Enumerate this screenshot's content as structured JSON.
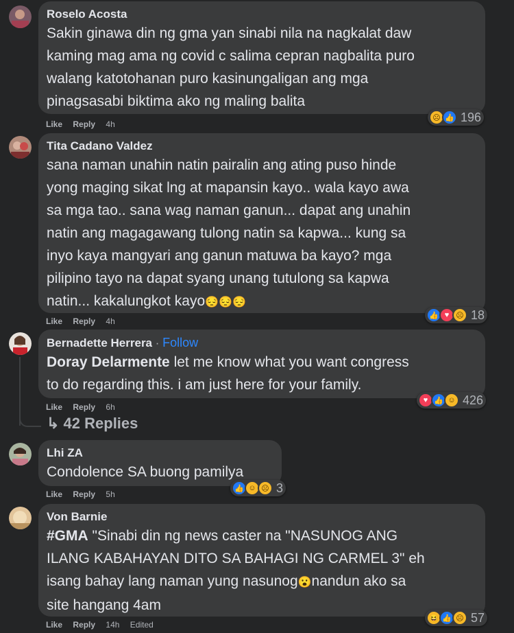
{
  "colors": {
    "background": "#242526",
    "bubble": "#3a3b3c",
    "link": "#2d88ff",
    "secondary": "#b0b3b8"
  },
  "comments": [
    {
      "author": "Roselo Acosta",
      "text": "Sakin ginawa din ng gma yan sinabi nila na nagkalat daw\nkaming mag ama ng covid c salima cepran nagbalita puro\nwalang katotohanan puro kasinungaligan ang mga\npinagsasabi biktima ako ng maling balita",
      "like": "Like",
      "reply": "Reply",
      "time": "4h",
      "reactions": [
        "sad",
        "like"
      ],
      "count": "196"
    },
    {
      "author": "Tita Cadano Valdez",
      "text": "sana naman unahin natin pairalin ang ating puso hinde\nyong maging sikat lng at mapansin kayo.. wala kayo awa\nsa mga tao.. sana wag naman ganun... dapat ang unahin\nnatin ang magagawang tulong natin sa kapwa... kung sa\ninyo kaya mangyari ang ganun matuwa ba kayo? mga\npilipino tayo na dapat syang unang tutulong sa kapwa\nnatin... kakalungkot kayo",
      "emoji_trail": "😔😔😔",
      "like": "Like",
      "reply": "Reply",
      "time": "4h",
      "reactions": [
        "like",
        "love",
        "sad"
      ],
      "count": "18"
    },
    {
      "author": "Bernadette Herrera",
      "dot": "·",
      "follow": "Follow",
      "mention": "Doray Delarmente",
      "text": " let me know what you want congress\nto do regarding this. i am just here for your family.",
      "like": "Like",
      "reply": "Reply",
      "time": "6h",
      "reactions": [
        "love",
        "like",
        "care"
      ],
      "count": "426",
      "replies_label": "↳ 42 Replies"
    },
    {
      "author": "Lhi ZA",
      "text": "Condolence SA buong pamilya",
      "like": "Like",
      "reply": "Reply",
      "time": "5h",
      "reactions": [
        "like",
        "care",
        "sad"
      ],
      "count": "3"
    },
    {
      "author": "Von Barnie",
      "tag": "#GMA",
      "text": " \"Sinabi din ng news caster na \"NASUNOG ANG\nILANG KABAHAYAN DITO SA BAHAGI NG CARMEL 3\" eh\nisang bahay lang naman yung nasunog",
      "emoji_mid": "😮",
      "text2": "nandun ako sa\nsite hangang 4am",
      "like": "Like",
      "reply": "Reply",
      "time": "14h",
      "edited": "Edited",
      "reactions": [
        "haha",
        "like",
        "sad"
      ],
      "count": "57"
    }
  ]
}
